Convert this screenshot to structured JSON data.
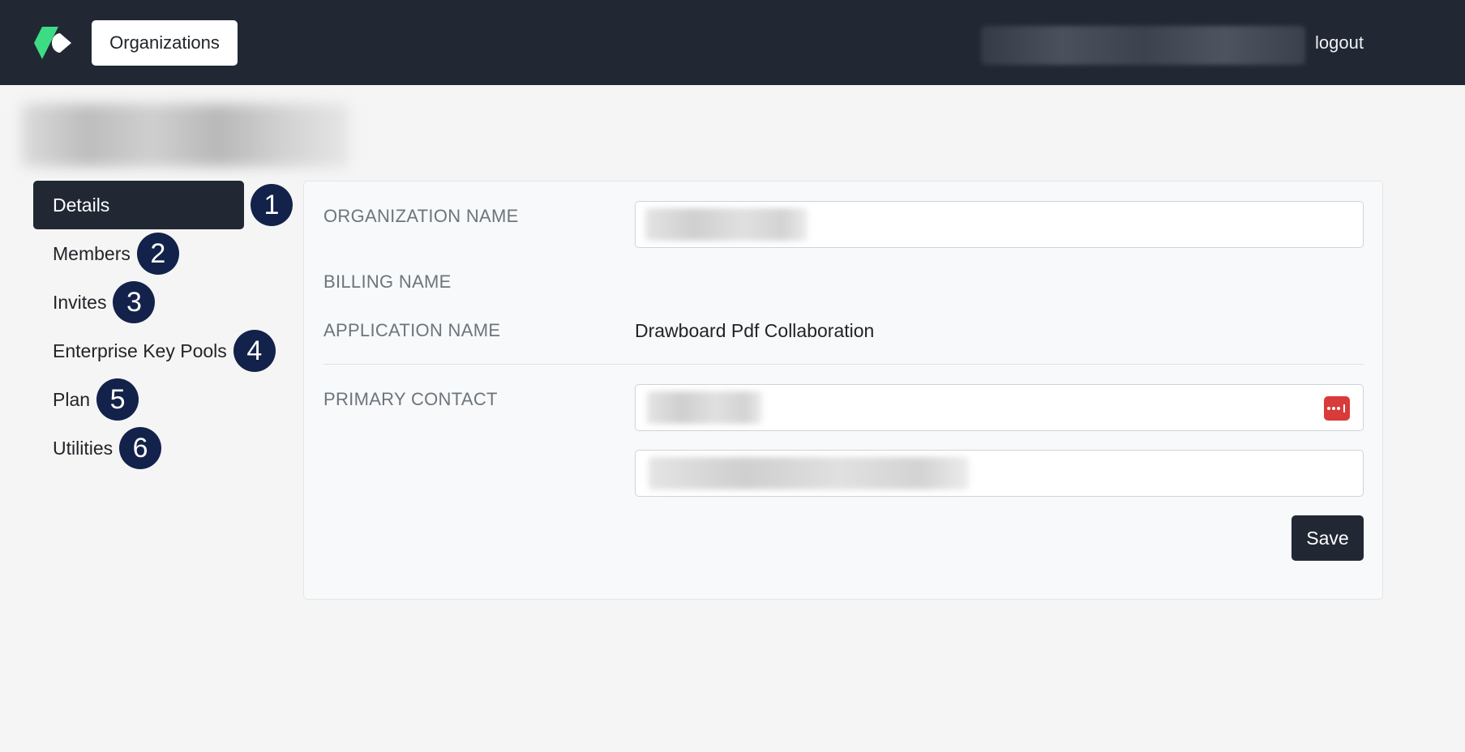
{
  "header": {
    "logo_icon": "drawboard-logo-icon",
    "organizations_label": "Organizations",
    "logout_label": "logout"
  },
  "sidebar": {
    "items": [
      {
        "label": "Details",
        "badge": "1",
        "active": true
      },
      {
        "label": "Members",
        "badge": "2",
        "active": false
      },
      {
        "label": "Invites",
        "badge": "3",
        "active": false
      },
      {
        "label": "Enterprise Key Pools",
        "badge": "4",
        "active": false
      },
      {
        "label": "Plan",
        "badge": "5",
        "active": false
      },
      {
        "label": "Utilities",
        "badge": "6",
        "active": false
      }
    ]
  },
  "details": {
    "organization_name_label": "ORGANIZATION NAME",
    "billing_name_label": "BILLING NAME",
    "application_name_label": "APPLICATION NAME",
    "application_name_value": "Drawboard Pdf Collaboration",
    "primary_contact_label": "PRIMARY CONTACT",
    "password_manager_icon": "password-manager-icon",
    "save_label": "Save"
  },
  "colors": {
    "navbar": "#212834",
    "active_nav": "#212834",
    "badge": "#13224a",
    "logo_green": "#3ddc84",
    "password_manager_red": "#d93a3a"
  }
}
